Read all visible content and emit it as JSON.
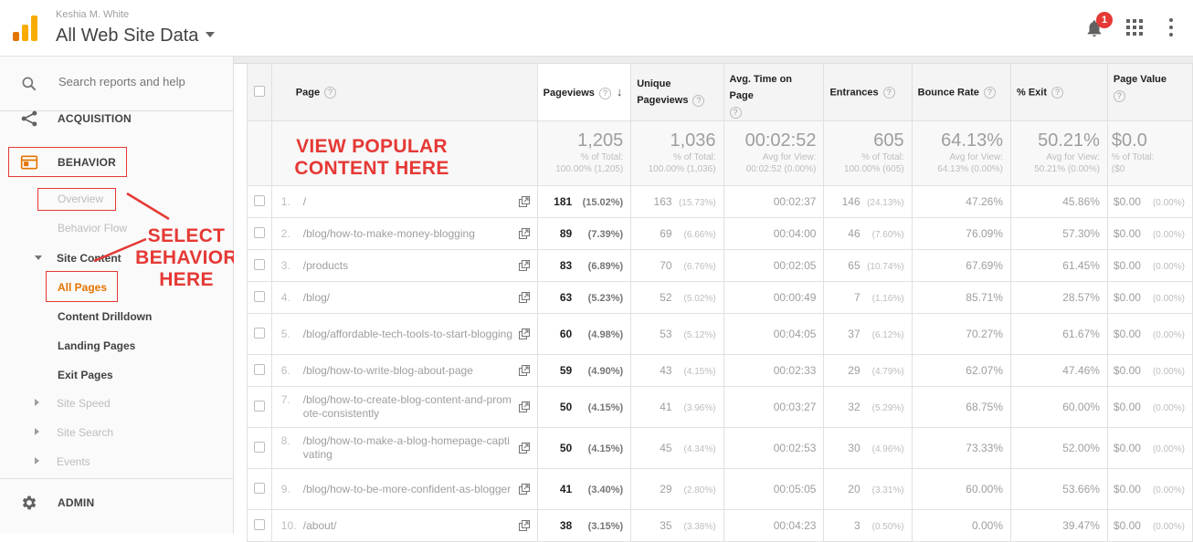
{
  "header": {
    "account_user": "Keshia M. White",
    "view_name": "All Web Site Data",
    "notification_count": "1"
  },
  "sidebar": {
    "search_placeholder": "Search reports and help",
    "acquisition": "ACQUISITION",
    "behavior": "BEHAVIOR",
    "overview": "Overview",
    "behavior_flow": "Behavior Flow",
    "site_content": "Site Content",
    "all_pages": "All Pages",
    "content_drilldown": "Content Drilldown",
    "landing_pages": "Landing Pages",
    "exit_pages": "Exit Pages",
    "site_speed": "Site Speed",
    "site_search": "Site Search",
    "events": "Events",
    "admin": "ADMIN"
  },
  "annotations": {
    "select_behavior": "SELECT\nBEHAVIOR\nHERE",
    "view_popular": "VIEW POPULAR\nCONTENT HERE"
  },
  "table": {
    "headers": {
      "page": "Page",
      "pageviews": "Pageviews",
      "unique_pageviews": "Unique\nPageviews",
      "avg_time": "Avg. Time on Page",
      "entrances": "Entrances",
      "bounce_rate": "Bounce Rate",
      "exit": "% Exit",
      "page_value": "Page Value"
    },
    "totals": {
      "pageviews": "1,205",
      "pageviews_sub": "% of Total:\n100.00% (1,205)",
      "unique": "1,036",
      "unique_sub": "% of Total:\n100.00% (1,036)",
      "avg_time": "00:02:52",
      "avg_time_sub": "Avg for View:\n00:02:52 (0.00%)",
      "entrances": "605",
      "entrances_sub": "% of Total:\n100.00% (605)",
      "bounce": "64.13%",
      "bounce_sub": "Avg for View:\n64.13% (0.00%)",
      "exit": "50.21%",
      "exit_sub": "Avg for View:\n50.21% (0.00%)",
      "value": "$0.0",
      "value_sub": "% of Total:\n($0"
    },
    "rows": [
      {
        "num": "1.",
        "page": "/",
        "pv": "181",
        "pv_pct": "(15.02%)",
        "upv": "163",
        "upv_pct": "(15.73%)",
        "time": "00:02:37",
        "ent": "146",
        "ent_pct": "(24.13%)",
        "bounce": "47.26%",
        "exit": "45.86%",
        "value": "$0.00",
        "value_pct": "(0.00%)"
      },
      {
        "num": "2.",
        "page": "/blog/how-to-make-money-blogging",
        "pv": "89",
        "pv_pct": "(7.39%)",
        "upv": "69",
        "upv_pct": "(6.66%)",
        "time": "00:04:00",
        "ent": "46",
        "ent_pct": "(7.60%)",
        "bounce": "76.09%",
        "exit": "57.30%",
        "value": "$0.00",
        "value_pct": "(0.00%)"
      },
      {
        "num": "3.",
        "page": "/products",
        "pv": "83",
        "pv_pct": "(6.89%)",
        "upv": "70",
        "upv_pct": "(6.76%)",
        "time": "00:02:05",
        "ent": "65",
        "ent_pct": "(10.74%)",
        "bounce": "67.69%",
        "exit": "61.45%",
        "value": "$0.00",
        "value_pct": "(0.00%)"
      },
      {
        "num": "4.",
        "page": "/blog/",
        "pv": "63",
        "pv_pct": "(5.23%)",
        "upv": "52",
        "upv_pct": "(5.02%)",
        "time": "00:00:49",
        "ent": "7",
        "ent_pct": "(1.16%)",
        "bounce": "85.71%",
        "exit": "28.57%",
        "value": "$0.00",
        "value_pct": "(0.00%)"
      },
      {
        "num": "5.",
        "page": "/blog/affordable-tech-tools-to-start-blogging",
        "pv": "60",
        "pv_pct": "(4.98%)",
        "upv": "53",
        "upv_pct": "(5.12%)",
        "time": "00:04:05",
        "ent": "37",
        "ent_pct": "(6.12%)",
        "bounce": "70.27%",
        "exit": "61.67%",
        "value": "$0.00",
        "value_pct": "(0.00%)"
      },
      {
        "num": "6.",
        "page": "/blog/how-to-write-blog-about-page",
        "pv": "59",
        "pv_pct": "(4.90%)",
        "upv": "43",
        "upv_pct": "(4.15%)",
        "time": "00:02:33",
        "ent": "29",
        "ent_pct": "(4.79%)",
        "bounce": "62.07%",
        "exit": "47.46%",
        "value": "$0.00",
        "value_pct": "(0.00%)"
      },
      {
        "num": "7.",
        "page": "/blog/how-to-create-blog-content-and-promote-consistently",
        "pv": "50",
        "pv_pct": "(4.15%)",
        "upv": "41",
        "upv_pct": "(3.96%)",
        "time": "00:03:27",
        "ent": "32",
        "ent_pct": "(5.29%)",
        "bounce": "68.75%",
        "exit": "60.00%",
        "value": "$0.00",
        "value_pct": "(0.00%)"
      },
      {
        "num": "8.",
        "page": "/blog/how-to-make-a-blog-homepage-captivating",
        "pv": "50",
        "pv_pct": "(4.15%)",
        "upv": "45",
        "upv_pct": "(4.34%)",
        "time": "00:02:53",
        "ent": "30",
        "ent_pct": "(4.96%)",
        "bounce": "73.33%",
        "exit": "52.00%",
        "value": "$0.00",
        "value_pct": "(0.00%)"
      },
      {
        "num": "9.",
        "page": "/blog/how-to-be-more-confident-as-blogger",
        "pv": "41",
        "pv_pct": "(3.40%)",
        "upv": "29",
        "upv_pct": "(2.80%)",
        "time": "00:05:05",
        "ent": "20",
        "ent_pct": "(3.31%)",
        "bounce": "60.00%",
        "exit": "53.66%",
        "value": "$0.00",
        "value_pct": "(0.00%)"
      },
      {
        "num": "10.",
        "page": "/about/",
        "pv": "38",
        "pv_pct": "(3.15%)",
        "upv": "35",
        "upv_pct": "(3.38%)",
        "time": "00:04:23",
        "ent": "3",
        "ent_pct": "(0.50%)",
        "bounce": "0.00%",
        "exit": "39.47%",
        "value": "$0.00",
        "value_pct": "(0.00%)"
      }
    ]
  },
  "colors": {
    "accent_orange": "#e37400",
    "annotation_red": "#e53935",
    "badge_red": "#e53935"
  }
}
